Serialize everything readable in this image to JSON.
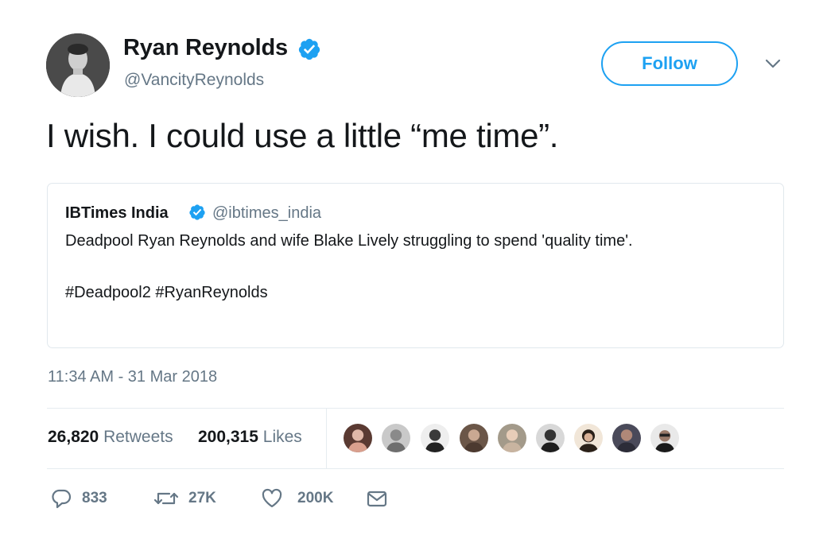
{
  "author": {
    "display_name": "Ryan Reynolds",
    "handle": "@VancityReynolds",
    "verified": true
  },
  "follow_label": "Follow",
  "tweet_text": "I wish. I could use a little “me time”.",
  "quoted": {
    "display_name": "IBTimes India",
    "handle": "@ibtimes_india",
    "verified": true,
    "text": "Deadpool Ryan Reynolds and wife Blake Lively struggling to spend 'quality time'.",
    "hashtags": "#Deadpool2 #RyanReynolds"
  },
  "timestamp": "11:34 AM - 31 Mar 2018",
  "stats": {
    "retweets_count": "26,820",
    "retweets_label": "Retweets",
    "likes_count": "200,315",
    "likes_label": "Likes"
  },
  "likers_count": 9,
  "actions": {
    "reply_count": "833",
    "retweet_count": "27K",
    "like_count": "200K"
  },
  "icons": {
    "verified": "verified-badge-icon",
    "caret": "chevron-down-icon",
    "reply": "reply-icon",
    "retweet": "retweet-icon",
    "like": "heart-icon",
    "dm": "envelope-icon"
  },
  "colors": {
    "accent": "#1da1f2",
    "text": "#14171a",
    "muted": "#657786",
    "border": "#e1e8ed"
  }
}
